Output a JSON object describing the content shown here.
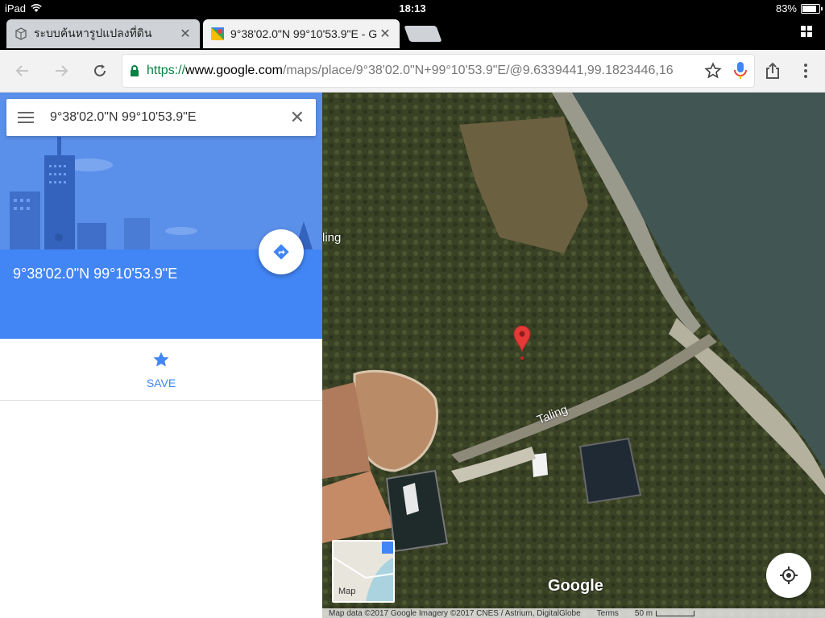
{
  "status_bar": {
    "device": "iPad",
    "time": "18:13",
    "battery": "83%",
    "battery_level": 0.83
  },
  "tabs": [
    {
      "title": "ระบบค้นหารูปแปลงที่ดิน",
      "active": false
    },
    {
      "title": "9°38'02.0\"N 99°10'53.9\"E - G",
      "active": true
    }
  ],
  "toolbar": {
    "url_scheme": "https://",
    "url_host": "www.google.com",
    "url_path": "/maps/place/9°38'02.0\"N+99°10'53.9\"E/@9.6339441,99.1823446,16"
  },
  "panel": {
    "search_value": "9°38'02.0\"N 99°10'53.9\"E",
    "place_title": "9°38'02.0\"N 99°10'53.9\"E",
    "save_label": "SAVE"
  },
  "map": {
    "road_labels": [
      "Taling",
      "ling"
    ],
    "thumbnail_label": "Map",
    "logo": "Google",
    "attribution": "Map data ©2017 Google Imagery ©2017 CNES / Astrium, DigitalGlobe",
    "terms": "Terms",
    "scale": "50 m"
  },
  "colors": {
    "brand_blue": "#4285f4",
    "pin_red": "#e53935"
  }
}
